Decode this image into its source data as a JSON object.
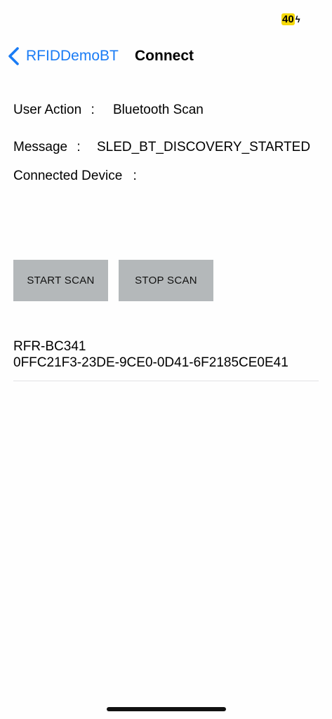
{
  "status_bar": {
    "battery_level": "40",
    "charging_icon": "bolt-icon"
  },
  "nav": {
    "back_label": "RFIDDemoBT",
    "back_icon": "chevron-left-icon",
    "title": "Connect"
  },
  "info": {
    "user_action": {
      "label": "User Action",
      "separator": ":",
      "value": "Bluetooth Scan"
    },
    "message": {
      "label": "Message",
      "separator": ":",
      "value": "SLED_BT_DISCOVERY_STARTED"
    },
    "connected_device": {
      "label": "Connected Device",
      "separator": ":",
      "value": ""
    }
  },
  "buttons": {
    "start_scan": "START SCAN",
    "stop_scan": "STOP SCAN"
  },
  "devices": [
    {
      "name": "RFR-BC341",
      "id": "0FFC21F3-23DE-9CE0-0D41-6F2185CE0E41"
    }
  ],
  "colors": {
    "accent": "#1a7cf5",
    "button_bg": "#b4b8ba",
    "battery": "#f5d90a"
  }
}
